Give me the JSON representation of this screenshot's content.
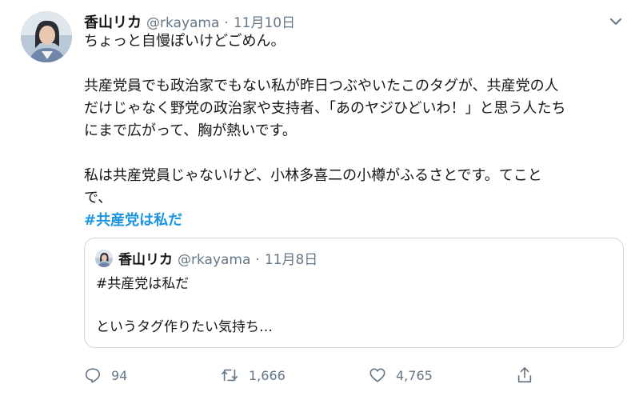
{
  "tweet": {
    "author_name": "香山リカ",
    "handle": "@rkayama",
    "separator": "·",
    "date": "11月10日",
    "lines": [
      "ちょっと自慢ぽいけどごめん。",
      "共産党員でも政治家でもない私が昨日つぶやいたこのタグが、共産党の人",
      "だけじゃなく野党の政治家や支持者、「あのヤジひどいわ！」と思う人たち",
      "にまで広がって、胸が熱いです。",
      "私は共産党員じゃないけど、小林多喜二の小樽がふるさとです。てこと",
      "で、"
    ],
    "hashtag": "#共産党は私だ"
  },
  "quoted_tweet": {
    "author_name": "香山リカ",
    "handle": "@rkayama",
    "separator": "·",
    "date": "11月8日",
    "line1": "#共産党は私だ",
    "line2": "というタグ作りたい気持ち…"
  },
  "actions": {
    "reply_count": "94",
    "retweet_count": "1,666",
    "like_count": "4,765"
  },
  "icons": {
    "caret": "chevron-down-icon",
    "reply": "reply-icon",
    "retweet": "retweet-icon",
    "like": "heart-icon",
    "share": "share-icon"
  },
  "colors": {
    "text": "#14171a",
    "secondary": "#657786",
    "link": "#1b95e0",
    "border": "#ccd6dd"
  }
}
